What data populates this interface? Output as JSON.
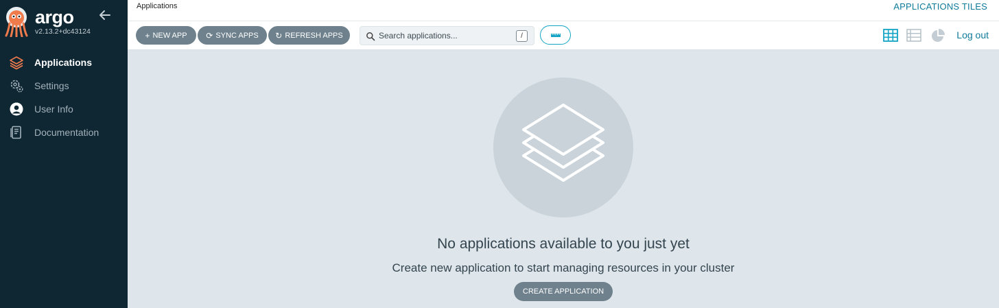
{
  "app": {
    "brand": "argo",
    "version": "v2.13.2+dc43124"
  },
  "sidebar": {
    "items": [
      {
        "label": "Applications",
        "icon": "layers-icon",
        "active": true
      },
      {
        "label": "Settings",
        "icon": "gears-icon",
        "active": false
      },
      {
        "label": "User Info",
        "icon": "user-circle-icon",
        "active": false
      },
      {
        "label": "Documentation",
        "icon": "book-icon",
        "active": false
      }
    ]
  },
  "header": {
    "title": "Applications",
    "view_title": "APPLICATIONS TILES"
  },
  "toolbar": {
    "new_app": "NEW APP",
    "sync_apps": "SYNC APPS",
    "refresh_apps": "REFRESH APPS",
    "search_placeholder": "Search applications...",
    "search_shortcut": "/",
    "logout": "Log out"
  },
  "empty_state": {
    "title": "No applications available to you just yet",
    "subtitle": "Create new application to start managing resources in your cluster",
    "button": "CREATE APPLICATION"
  },
  "colors": {
    "sidebar_bg": "#0f2733",
    "accent": "#13a4c5",
    "button_bg": "#6e818c",
    "content_bg": "#dee6eb"
  }
}
